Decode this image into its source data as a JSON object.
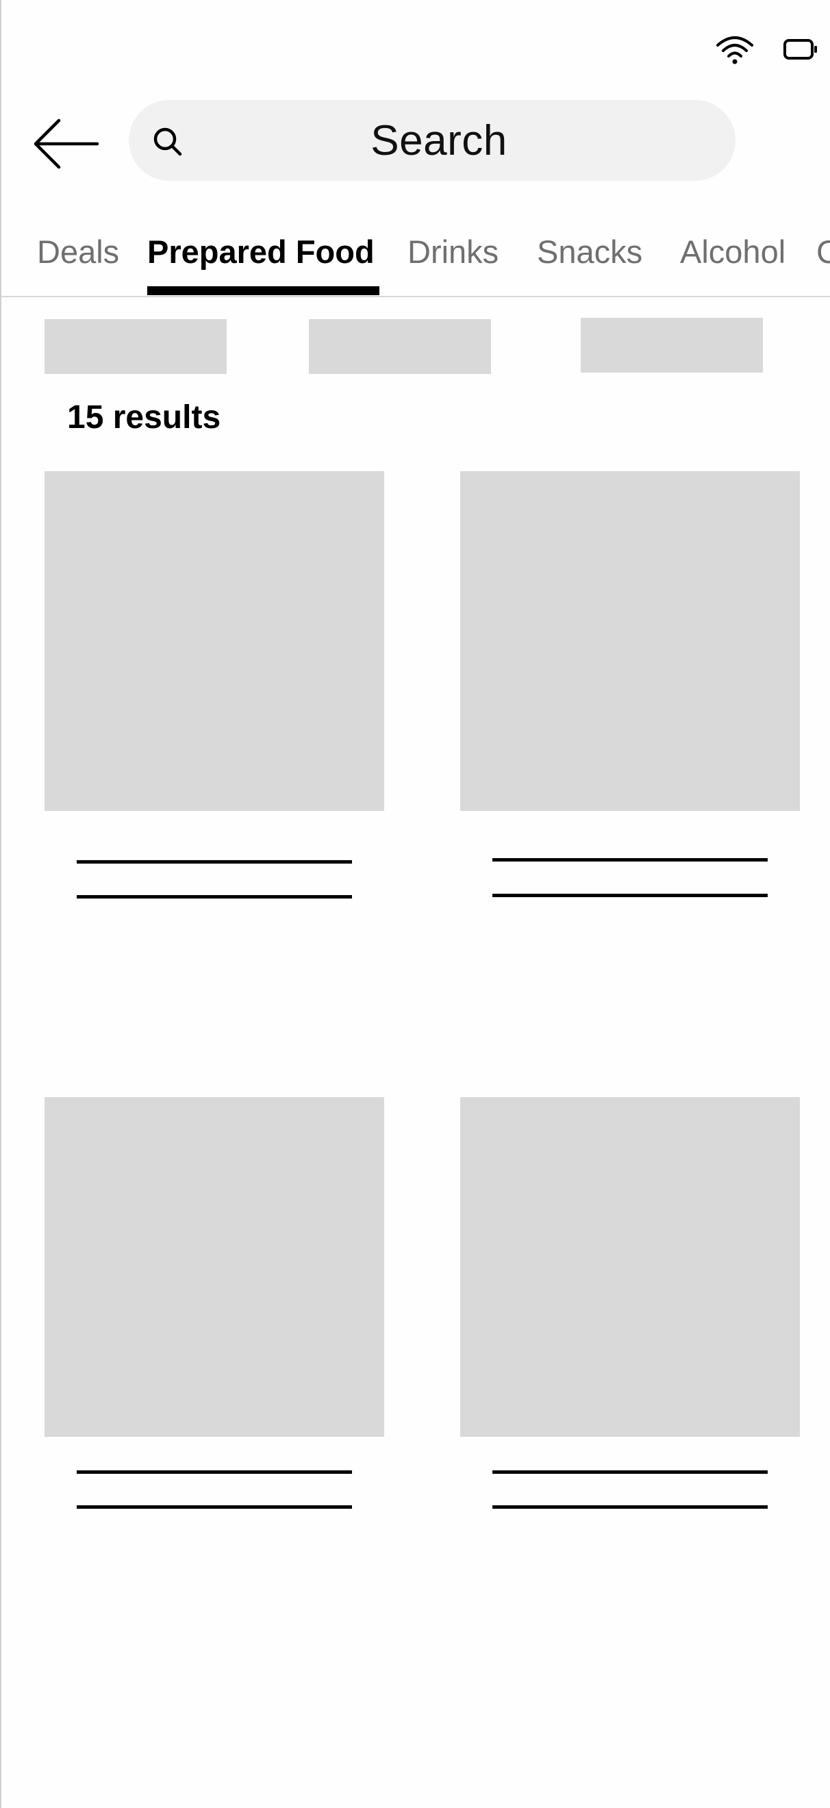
{
  "status_bar": {
    "wifi_icon": "wifi-icon",
    "battery_icon": "battery-icon"
  },
  "header": {
    "back_icon": "arrow-left-icon",
    "search": {
      "icon": "search-icon",
      "label": "Search"
    }
  },
  "tabs": [
    {
      "label": "Deals",
      "active": false
    },
    {
      "label": "Prepared Food",
      "active": true
    },
    {
      "label": "Drinks",
      "active": false
    },
    {
      "label": "Snacks",
      "active": false
    },
    {
      "label": "Alcohol",
      "active": false
    },
    {
      "label": "C",
      "active": false
    }
  ],
  "results": {
    "count_label": "15 results"
  },
  "colors": {
    "placeholder": "#d9d9d9",
    "search_bg": "#f1f1f1",
    "active_tab": "#000000",
    "inactive_tab": "#6f6f6f"
  }
}
